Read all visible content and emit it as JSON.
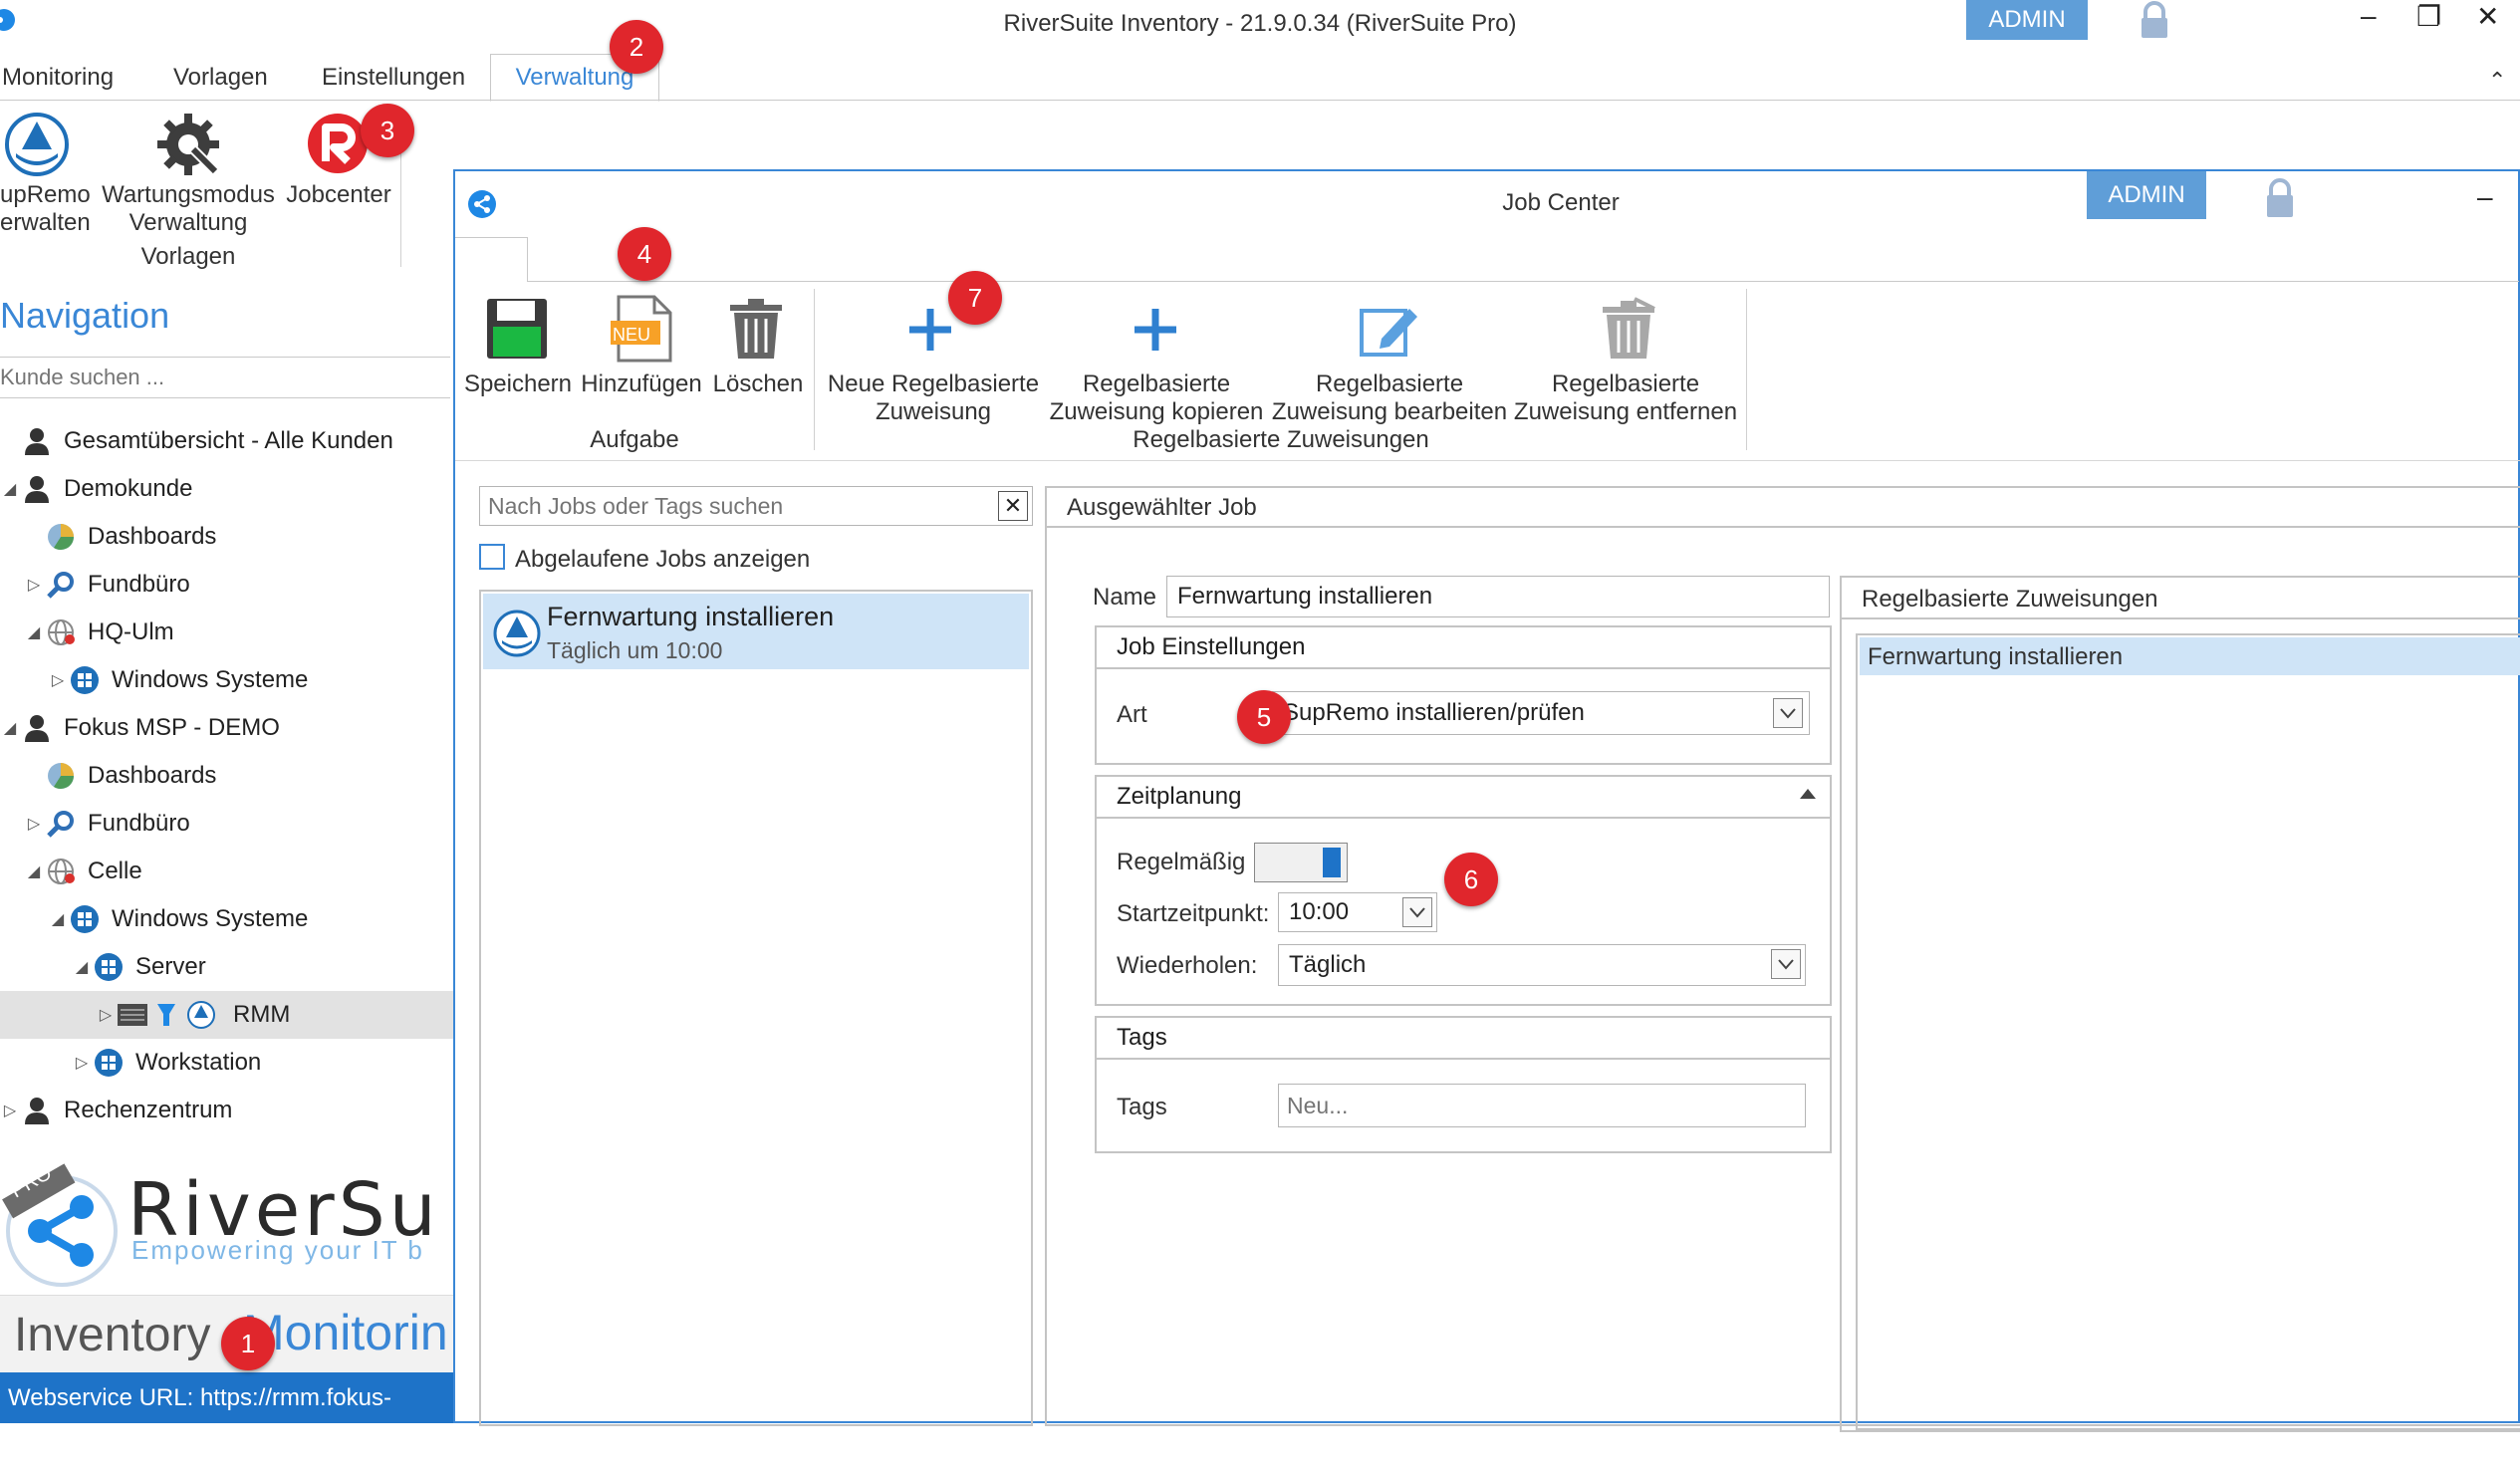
{
  "window": {
    "title": "RiverSuite Inventory - 21.9.0.34 (RiverSuite Pro)",
    "admin_label": "ADMIN",
    "controls": [
      "–",
      "❐",
      "✕"
    ]
  },
  "ribbon": {
    "tabs": [
      "Monitoring",
      "Vorlagen",
      "Einstellungen",
      "Verwaltung"
    ],
    "buttons": [
      {
        "label_line1": "upRemo",
        "label_line2": "erwalten",
        "icon": "supremo-icon"
      },
      {
        "label_line1": "Wartungsmodus",
        "label_line2": "Verwaltung",
        "icon": "gear-wrench-icon"
      },
      {
        "label_line1": "Jobcenter",
        "label_line2": "",
        "icon": "jobcenter-logo-icon"
      }
    ],
    "group_label": "Vorlagen"
  },
  "navigation": {
    "title": "Navigation",
    "search_placeholder": "Kunde suchen ...",
    "items": [
      {
        "label": "Gesamtübersicht - Alle Kunden",
        "icon": "person-icon",
        "level": 0,
        "arrow": ""
      },
      {
        "label": "Demokunde",
        "icon": "person-icon",
        "level": 0,
        "arrow": "◢"
      },
      {
        "label": "Dashboards",
        "icon": "pie-chart-icon",
        "level": 1,
        "arrow": ""
      },
      {
        "label": "Fundbüro",
        "icon": "magnifier-icon",
        "level": 1,
        "arrow": "▷"
      },
      {
        "label": "HQ-Ulm",
        "icon": "globe-icon",
        "level": 1,
        "arrow": "◢"
      },
      {
        "label": "Windows Systeme",
        "icon": "windows-icon",
        "level": 2,
        "arrow": "▷"
      },
      {
        "label": "Fokus MSP - DEMO",
        "icon": "person-icon",
        "level": 0,
        "arrow": "◢"
      },
      {
        "label": "Dashboards",
        "icon": "pie-chart-icon",
        "level": 1,
        "arrow": ""
      },
      {
        "label": "Fundbüro",
        "icon": "magnifier-icon",
        "level": 1,
        "arrow": "▷"
      },
      {
        "label": "Celle",
        "icon": "globe-icon",
        "level": 1,
        "arrow": "◢"
      },
      {
        "label": "Windows Systeme",
        "icon": "windows-icon",
        "level": 2,
        "arrow": "◢"
      },
      {
        "label": "Server",
        "icon": "windows-icon",
        "level": 3,
        "arrow": "◢"
      },
      {
        "label": "RMM",
        "icon": "rmm-icons",
        "level": 4,
        "arrow": "▷"
      },
      {
        "label": "Workstation",
        "icon": "windows-icon",
        "level": 3,
        "arrow": "▷"
      },
      {
        "label": "Rechenzentrum",
        "icon": "person-icon",
        "level": 0,
        "arrow": "▷"
      }
    ]
  },
  "brand": {
    "name": "RiverSu",
    "tagline": "Empowering your IT b",
    "badge": "PRO"
  },
  "footer": {
    "tab_inventory": "Inventory",
    "tab_monitoring": "Monitorin",
    "url": "Webservice URL: https://rmm.fokus-msp.d"
  },
  "job_center": {
    "title": "Job Center",
    "admin_label": "ADMIN",
    "minimize": "–",
    "toolbar": {
      "aufgabe": {
        "label": "Aufgabe",
        "buttons": [
          {
            "line1": "Speichern",
            "line2": "",
            "icon": "floppy-save-icon"
          },
          {
            "line1": "Hinzufügen",
            "line2": "",
            "icon": "new-document-icon",
            "badge": "NEU"
          },
          {
            "line1": "Löschen",
            "line2": "",
            "icon": "trash-icon"
          }
        ]
      },
      "regelbasiert": {
        "label": "Regelbasierte Zuweisungen",
        "buttons": [
          {
            "line1": "Neue Regelbasierte",
            "line2": "Zuweisung",
            "icon": "plus-icon"
          },
          {
            "line1": "Regelbasierte",
            "line2": "Zuweisung kopieren",
            "icon": "plus-icon"
          },
          {
            "line1": "Regelbasierte",
            "line2": "Zuweisung bearbeiten",
            "icon": "edit-icon"
          },
          {
            "line1": "Regelbasierte",
            "line2": "Zuweisung entfernen",
            "icon": "trash-disabled-icon"
          }
        ]
      }
    },
    "job_list": {
      "search_placeholder": "Nach Jobs oder Tags suchen",
      "show_expired_label": "Abgelaufene Jobs anzeigen",
      "show_expired_checked": false,
      "jobs": [
        {
          "name": "Fernwartung installieren",
          "schedule": "Täglich um 10:00"
        }
      ]
    },
    "selected_job": {
      "header": "Ausgewählter Job",
      "name_label": "Name",
      "name_value": "Fernwartung installieren",
      "job_settings": {
        "header": "Job Einstellungen",
        "art_label": "Art",
        "art_value": "SupRemo installieren/prüfen"
      },
      "scheduling": {
        "header": "Zeitplanung",
        "regular_label": "Regelmäßig",
        "regular_on": true,
        "start_label": "Startzeitpunkt:",
        "start_value": "10:00",
        "repeat_label": "Wiederholen:",
        "repeat_value": "Täglich"
      },
      "tags": {
        "header": "Tags",
        "tags_label": "Tags",
        "tags_placeholder": "Neu..."
      }
    },
    "rule_assignments": {
      "header": "Regelbasierte Zuweisungen",
      "items": [
        "Fernwartung installieren"
      ]
    }
  },
  "markers": [
    "1",
    "2",
    "3",
    "4",
    "5",
    "6",
    "7"
  ],
  "colors": {
    "accent_blue": "#3a87d6",
    "admin_blue": "#5f9ed8",
    "marker_red": "#e0262c",
    "selection": "#cfe4f7",
    "url_bar": "#1e73c8"
  }
}
